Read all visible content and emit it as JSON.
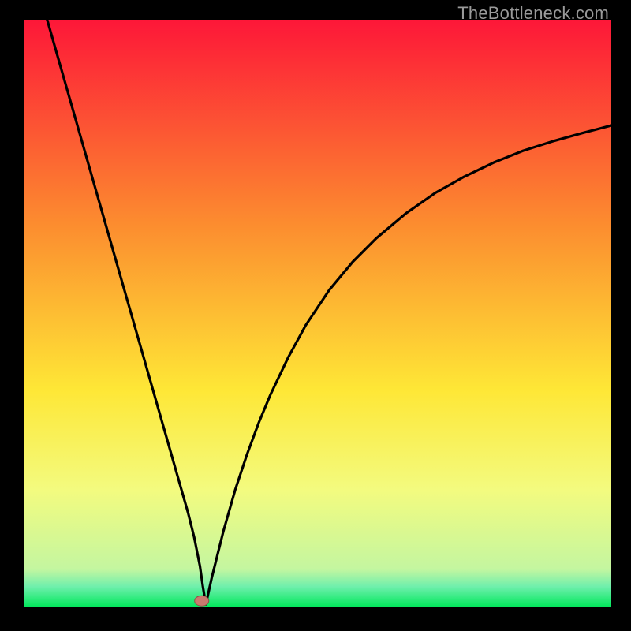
{
  "watermark": "TheBottleneck.com",
  "colors": {
    "background_black": "#000000",
    "watermark_gray": "#9a9a9a",
    "gradient_top": "#fd1738",
    "gradient_mid1": "#fc8d2f",
    "gradient_mid2": "#fee736",
    "gradient_mid3": "#f3fb7f",
    "gradient_bottom": "#00e85a",
    "curve": "#000000",
    "marker_fill": "#c97a6e",
    "marker_stroke": "#915047"
  },
  "chart_data": {
    "type": "line",
    "title": "",
    "xlabel": "",
    "ylabel": "",
    "xlim": [
      0,
      100
    ],
    "ylim": [
      0,
      100
    ],
    "annotations": [],
    "curve": {
      "x": [
        4.0,
        6.0,
        8.0,
        10.0,
        12.0,
        14.0,
        16.0,
        18.0,
        20.0,
        22.0,
        24.0,
        26.0,
        27.0,
        28.0,
        29.0,
        30.0,
        30.5,
        31.0,
        32.0,
        33.0,
        34.0,
        35.0,
        36.0,
        38.0,
        40.0,
        42.0,
        45.0,
        48.0,
        52.0,
        56.0,
        60.0,
        65.0,
        70.0,
        75.0,
        80.0,
        85.0,
        90.0,
        95.0,
        100.0
      ],
      "y": [
        100.0,
        93.0,
        86.0,
        79.0,
        72.0,
        65.0,
        58.0,
        51.0,
        44.0,
        37.0,
        30.0,
        23.0,
        19.5,
        16.0,
        12.0,
        7.0,
        3.5,
        0.5,
        5.0,
        9.0,
        13.0,
        16.5,
        20.0,
        26.0,
        31.4,
        36.2,
        42.5,
        48.0,
        54.0,
        58.8,
        62.8,
        67.0,
        70.5,
        73.3,
        75.7,
        77.7,
        79.3,
        80.7,
        82.0
      ]
    },
    "marker": {
      "x": 30.3,
      "y": 1.1
    },
    "gradient_stops": [
      {
        "offset": 0.0,
        "color": "#fd1738"
      },
      {
        "offset": 0.35,
        "color": "#fc8d2f"
      },
      {
        "offset": 0.63,
        "color": "#fee736"
      },
      {
        "offset": 0.8,
        "color": "#f3fb7f"
      },
      {
        "offset": 0.935,
        "color": "#c4f6a0"
      },
      {
        "offset": 0.965,
        "color": "#6eefac"
      },
      {
        "offset": 1.0,
        "color": "#00e85a"
      }
    ]
  }
}
